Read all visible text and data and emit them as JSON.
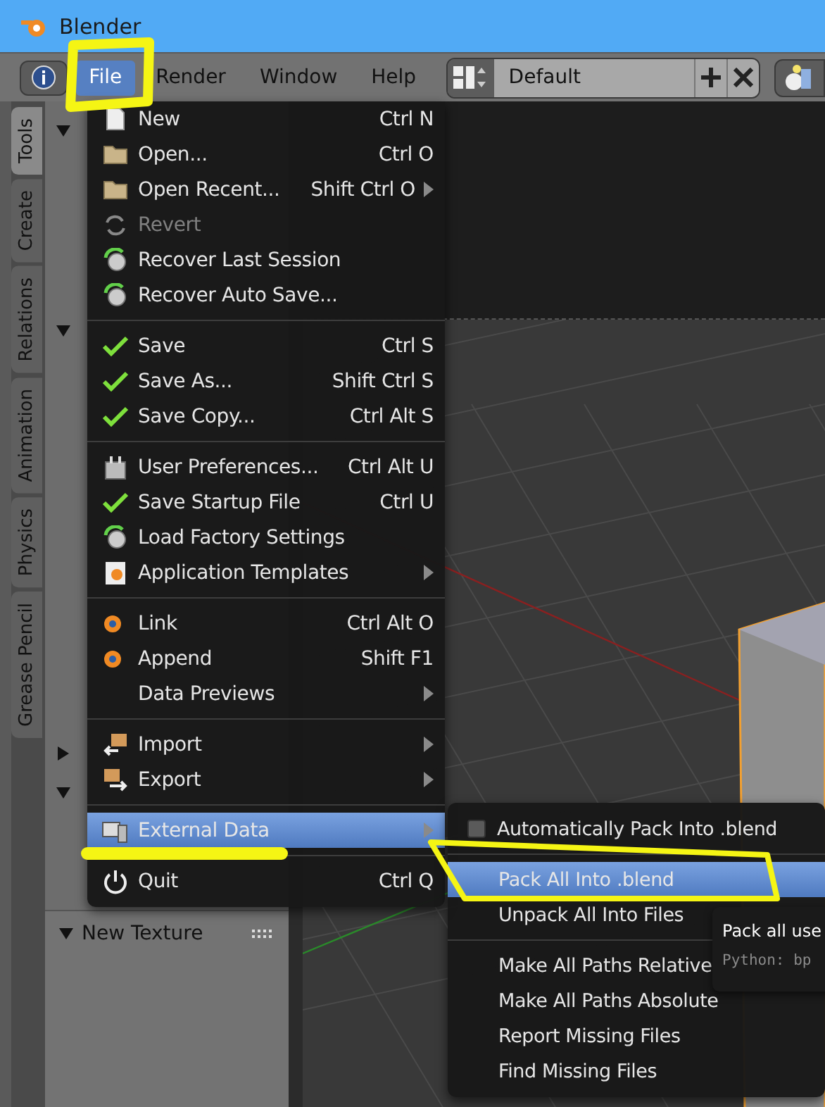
{
  "window": {
    "title": "Blender"
  },
  "menubar": {
    "items": [
      {
        "label": "File",
        "selected": true
      },
      {
        "label": "Render",
        "selected": false
      },
      {
        "label": "Window",
        "selected": false
      },
      {
        "label": "Help",
        "selected": false
      }
    ],
    "layout_field": "Default"
  },
  "tool_tabs": [
    {
      "label": "Tools",
      "selected": true
    },
    {
      "label": "Create",
      "selected": false
    },
    {
      "label": "Relations",
      "selected": false
    },
    {
      "label": "Animation",
      "selected": false
    },
    {
      "label": "Physics",
      "selected": false
    },
    {
      "label": "Grease Pencil",
      "selected": false
    }
  ],
  "panel": {
    "section_title": "New Texture"
  },
  "file_menu": {
    "sections": [
      [
        {
          "label": "New",
          "shortcut": "Ctrl N",
          "submenu": false,
          "disabled": false,
          "selected": false
        },
        {
          "label": "Open...",
          "shortcut": "Ctrl O",
          "submenu": false,
          "disabled": false,
          "selected": false
        },
        {
          "label": "Open Recent...",
          "shortcut": "Shift Ctrl O",
          "submenu": true,
          "disabled": false,
          "selected": false
        },
        {
          "label": "Revert",
          "submenu": false,
          "disabled": true,
          "selected": false
        },
        {
          "label": "Recover Last Session",
          "submenu": false,
          "disabled": false,
          "selected": false
        },
        {
          "label": "Recover Auto Save...",
          "submenu": false,
          "disabled": false,
          "selected": false
        }
      ],
      [
        {
          "label": "Save",
          "shortcut": "Ctrl S",
          "submenu": false,
          "disabled": false,
          "selected": false
        },
        {
          "label": "Save As...",
          "shortcut": "Shift Ctrl S",
          "submenu": false,
          "disabled": false,
          "selected": false
        },
        {
          "label": "Save Copy...",
          "shortcut": "Ctrl Alt S",
          "submenu": false,
          "disabled": false,
          "selected": false
        }
      ],
      [
        {
          "label": "User Preferences...",
          "shortcut": "Ctrl Alt U",
          "submenu": false,
          "disabled": false,
          "selected": false
        },
        {
          "label": "Save Startup File",
          "shortcut": "Ctrl U",
          "submenu": false,
          "disabled": false,
          "selected": false
        },
        {
          "label": "Load Factory Settings",
          "submenu": false,
          "disabled": false,
          "selected": false
        },
        {
          "label": "Application Templates",
          "submenu": true,
          "disabled": false,
          "selected": false
        }
      ],
      [
        {
          "label": "Link",
          "shortcut": "Ctrl Alt O",
          "submenu": false,
          "disabled": false,
          "selected": false
        },
        {
          "label": "Append",
          "shortcut": "Shift F1",
          "submenu": false,
          "disabled": false,
          "selected": false
        },
        {
          "label": "Data Previews",
          "submenu": true,
          "disabled": false,
          "selected": false
        }
      ],
      [
        {
          "label": "Import",
          "submenu": true,
          "disabled": false,
          "selected": false
        },
        {
          "label": "Export",
          "submenu": true,
          "disabled": false,
          "selected": false
        }
      ],
      [
        {
          "label": "External Data",
          "submenu": true,
          "disabled": false,
          "selected": true
        }
      ],
      [
        {
          "label": "Quit",
          "shortcut": "Ctrl Q",
          "submenu": false,
          "disabled": false,
          "selected": false
        }
      ]
    ]
  },
  "external_data_menu": {
    "sections": [
      [
        {
          "kind": "checkbox",
          "label": "Automatically Pack Into .blend",
          "checked": false,
          "selected": false
        }
      ],
      [
        {
          "kind": "action",
          "label": "Pack All Into .blend",
          "selected": true
        },
        {
          "kind": "action",
          "label": "Unpack All Into Files",
          "selected": false
        }
      ],
      [
        {
          "kind": "action",
          "label": "Make All Paths Relative",
          "selected": false
        },
        {
          "kind": "action",
          "label": "Make All Paths Absolute",
          "selected": false
        },
        {
          "kind": "action",
          "label": "Report Missing Files",
          "selected": false
        },
        {
          "kind": "action",
          "label": "Find Missing Files",
          "selected": false
        }
      ]
    ]
  },
  "tooltip": {
    "text": "Pack all use",
    "python": "Python: bp"
  }
}
